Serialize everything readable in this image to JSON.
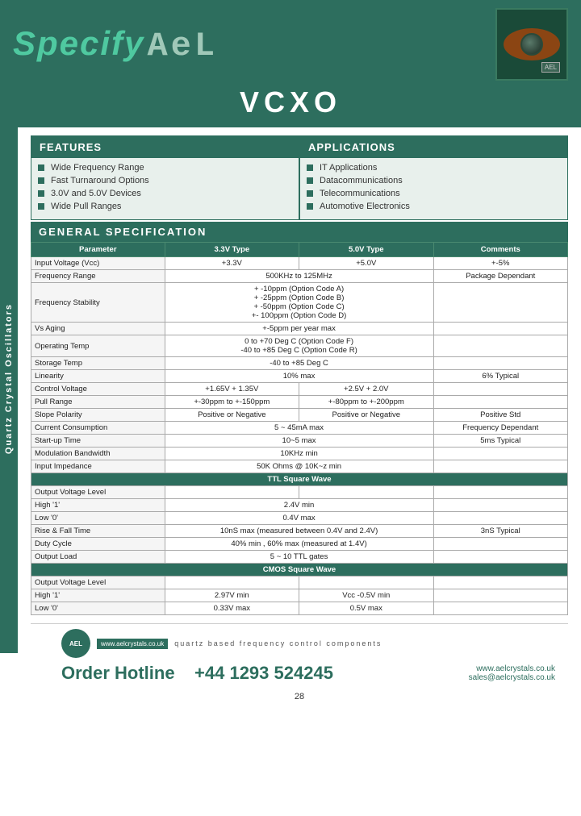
{
  "header": {
    "logo_specify": "Specify",
    "logo_ael": "ΑϵL",
    "title": "VCXO"
  },
  "side_label": "Quartz Crystal Oscillators",
  "features": {
    "header": "FEATURES",
    "items": [
      "Wide Frequency Range",
      "Fast Turnaround Options",
      "3.0V and 5.0V Devices",
      "Wide Pull Ranges"
    ]
  },
  "applications": {
    "header": "APPLICATIONS",
    "items": [
      "IT Applications",
      "Datacommunications",
      "Telecommunications",
      "Automotive Electronics"
    ]
  },
  "general_spec": {
    "header": "GENERAL   SPECIFICATION"
  },
  "table": {
    "columns": [
      "Parameter",
      "3.3V Type",
      "5.0V Type",
      "Comments"
    ],
    "rows": [
      [
        "Input Voltage (Vcc)",
        "+3.3V",
        "+5.0V",
        "+-5%"
      ],
      [
        "Frequency Range",
        "500KHz to 125MHz",
        "",
        "Package Dependant"
      ],
      [
        "",
        "",
        "",
        ""
      ],
      [
        "",
        "+ -10ppm (Option Code A)",
        "",
        ""
      ],
      [
        "Frequency Stability",
        "+ -25ppm (Option Code B)",
        "",
        ""
      ],
      [
        "",
        "+ -50ppm (Option Code C)",
        "",
        ""
      ],
      [
        "",
        "+- 100ppm (Option Code D)",
        "",
        ""
      ],
      [
        "Vs Aging",
        "+-5ppm per year max",
        "",
        ""
      ],
      [
        "Operating Temp",
        "0 to +70 Deg C (Option Code F)",
        "",
        ""
      ],
      [
        "",
        "-40 to +85 Deg C (Option Code R)",
        "",
        ""
      ],
      [
        "Storage Temp",
        "-40 to +85 Deg C",
        "",
        ""
      ],
      [
        "Linearity",
        "10% max",
        "",
        "6% Typical"
      ],
      [
        "Control Voltage",
        "+1.65V + 1.35V",
        "+2.5V + 2.0V",
        ""
      ],
      [
        "Pull Range",
        "+-30ppm to +-150ppm",
        "+-80ppm to +-200ppm",
        ""
      ],
      [
        "Slope Polarity",
        "Positive or Negative",
        "Positive or Negative",
        "Positive Std"
      ],
      [
        "Current Consumption",
        "5 ~ 45mA max",
        "",
        "Frequency Dependant"
      ],
      [
        "Start-up Time",
        "10~5 max",
        "",
        "5ms Typical"
      ],
      [
        "Modulation Bandwidth",
        "10KHz min",
        "",
        ""
      ],
      [
        "Input Impedance",
        "50K Ohms @ 10K~z min",
        "",
        ""
      ],
      [
        "TTL_SECTION",
        "",
        "",
        ""
      ],
      [
        "Output Voltage Level",
        "",
        "",
        ""
      ],
      [
        "High '1'",
        "2.4V min",
        "",
        ""
      ],
      [
        "Low '0'",
        "0.4V max",
        "",
        ""
      ],
      [
        "Rise & Fall Time",
        "10nS max (measured between 0.4V and 2.4V)",
        "",
        "3nS Typical"
      ],
      [
        "Duty Cycle",
        "40% min , 60% max (measured at 1.4V)",
        "",
        ""
      ],
      [
        "Output Load",
        "5 ~ 10 TTL gates",
        "",
        ""
      ],
      [
        "CMOS_SECTION",
        "",
        "",
        ""
      ],
      [
        "Output Voltage Level",
        "",
        "",
        ""
      ],
      [
        "High '1'",
        "2.97V min",
        "Vcc -0.5V min",
        ""
      ],
      [
        "Low '0'",
        "0.33V max",
        "0.5V max",
        ""
      ]
    ]
  },
  "footer": {
    "logo_text": "AEL",
    "website_badge": "www.aelcrystals.co.uk",
    "tagline": "quartz based frequency control components",
    "order_label": "Order Hotline",
    "phone": "+44 1293 524245",
    "website1": "www.aelcrystals.co.uk",
    "email": "sales@aelcrystals.co.uk",
    "page_number": "28"
  }
}
